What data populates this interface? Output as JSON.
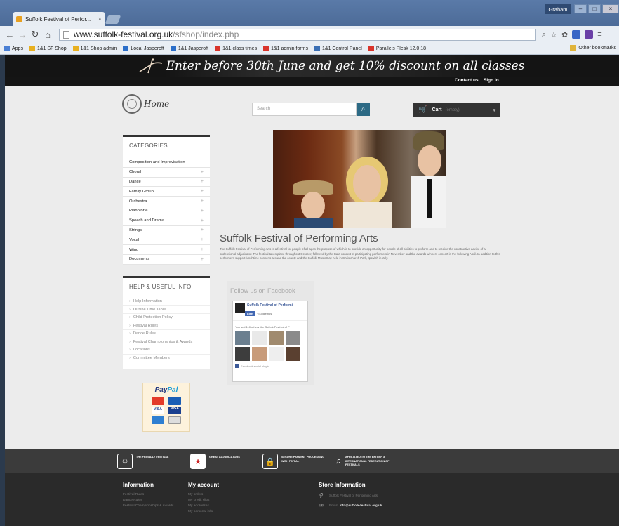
{
  "browser": {
    "tab_title": "Suffolk Festival of Perfor...",
    "url_host": "www.suffolk-festival.org.uk",
    "url_path": "/sfshop/index.php",
    "user": "Graham",
    "bookmarks": [
      "Apps",
      "1&1 SF Shop",
      "1&1 Shop admin",
      "Local Jasperoft",
      "1&1 Jasperoft",
      "1&1 class times",
      "1&1 admin forms",
      "1&1 Control Panel",
      "Parallels Plesk 12.0.18"
    ],
    "other_bookmarks": "Other bookmarks"
  },
  "site": {
    "banner": "Enter before 30th June and get 10% discount on all classes",
    "contact": "Contact us",
    "signin": "Sign in",
    "logo": "Home",
    "search_placeholder": "Search",
    "cart_label": "Cart",
    "cart_status": "(empty)"
  },
  "categories": {
    "title": "CATEGORIES",
    "items": [
      {
        "label": "Composition and Improvisation",
        "plus": ""
      },
      {
        "label": "Choral",
        "plus": "+"
      },
      {
        "label": "Dance",
        "plus": "+"
      },
      {
        "label": "Family Group",
        "plus": "+"
      },
      {
        "label": "Orchestra",
        "plus": "+"
      },
      {
        "label": "Pianoforte",
        "plus": "+"
      },
      {
        "label": "Speech and Drama",
        "plus": "+"
      },
      {
        "label": "Strings",
        "plus": "+"
      },
      {
        "label": "Vocal",
        "plus": "+"
      },
      {
        "label": "Wind",
        "plus": "+"
      },
      {
        "label": "Documents",
        "plus": "+"
      }
    ]
  },
  "help": {
    "title": "HELP & USEFUL INFO",
    "items": [
      "Help Information",
      "Outline Time Table",
      "Child Protection Policy",
      "Festival Rules",
      "Dance Rules",
      "Festival Championships & Awards",
      "Locations",
      "Committee Members"
    ]
  },
  "paypal": {
    "brand_a": "Pay",
    "brand_b": "Pal",
    "cards": [
      "MasterCard",
      "Maestro",
      "VISA",
      "VISA",
      "AMEX",
      "Discover"
    ]
  },
  "main": {
    "heading": "Suffolk Festival of Performing Arts",
    "intro": "The Suffolk Festival of Performing Arts is a festival for people of all ages the purpose of which is to provide an opportunity for people of all abilities to perform and to receive the constructive advice of a professional adjudicator. The festival takes place throughout October, followed by the Gala concert of participating performers in November and the awards winners concert in the following April. In addition to this performers support lunchtime concerts around the county and the Suffolk Music Day held in Christchurch Park, Ipswich in July."
  },
  "facebook": {
    "title": "Follow us on Facebook",
    "page_name": "Suffolk Festival of Performi",
    "like": "Like",
    "you_like": "You like this",
    "count_text": "You and 110 others like Suffolk Festival of P",
    "plugin": "Facebook social plugin"
  },
  "reassurance": [
    {
      "icon": "smile-icon",
      "glyph": "☺",
      "text": "THE FRIENDLY FESTIVAL"
    },
    {
      "icon": "adjudicator-icon",
      "glyph": "★",
      "text": "GREAT ADJUDICATORS"
    },
    {
      "icon": "lock-icon",
      "glyph": "🔒",
      "text": "SECURE PAYMENT PROCESSING WITH PAYPAL"
    },
    {
      "icon": "federation-icon",
      "glyph": "♫",
      "text": "AFFILIATED TO THE BRITISH & INTERNATIONAL FEDERATION OF FESTIVALS"
    }
  ],
  "footer": {
    "info_title": "Information",
    "info_links": [
      "Festival Rules",
      "Dance Rules",
      "Festival Championships & Awards"
    ],
    "account_title": "My account",
    "account_links": [
      "My orders",
      "My credit slips",
      "My addresses",
      "My personal info"
    ],
    "store_title": "Store Information",
    "store_name": "Suffolk Festival of Performing Arts",
    "email_label": "Email:",
    "email": "info@suffolk-festival.org.uk"
  }
}
